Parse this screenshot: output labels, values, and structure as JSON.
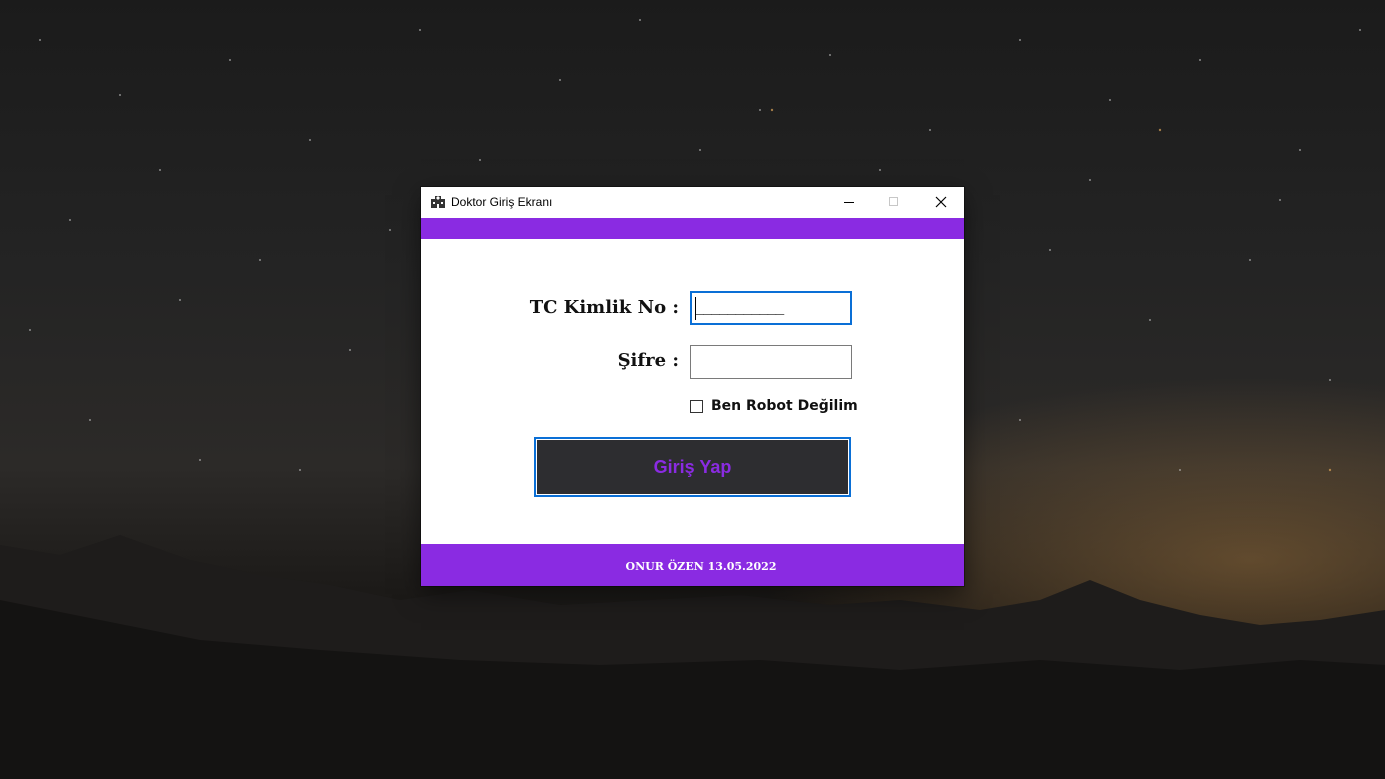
{
  "window": {
    "title": "Doktor Giriş Ekranı",
    "app_icon": "hospital-icon",
    "controls": {
      "minimize_icon": "minimize-icon",
      "maximize_icon": "maximize-icon",
      "close_icon": "close-icon"
    }
  },
  "form": {
    "tc_label": "TC Kimlik No :",
    "tc_value": "___________",
    "sifre_label": "Şifre :",
    "sifre_value": "",
    "robot_checkbox": {
      "label": "Ben Robot Değilim",
      "checked": false
    },
    "login_button": "Giriş Yap"
  },
  "footer": {
    "text": "ONUR ÖZEN 13.05.2022"
  },
  "colors": {
    "accent_purple": "#8a2be2",
    "button_bg": "#2d2d30",
    "focus_blue": "#0a6fd6"
  }
}
